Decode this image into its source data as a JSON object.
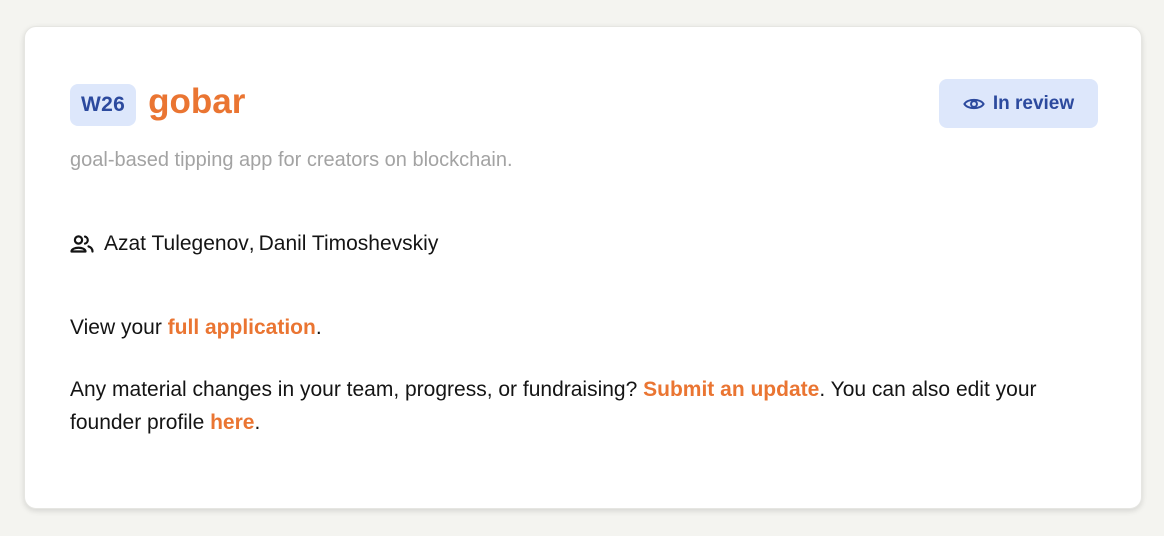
{
  "header": {
    "batch": "W26",
    "company_name": "gobar",
    "tagline": "goal-based tipping app for creators on blockchain."
  },
  "status": {
    "label": "In review",
    "icon": "eye-icon",
    "background": "#dde7fb",
    "color": "#2c4a9e"
  },
  "founders": {
    "icon": "people-icon",
    "names": [
      "Azat Tulegenov",
      "Danil Timoshevskiy"
    ],
    "separator": ","
  },
  "application": {
    "prefix": "View your",
    "link_label": "full application",
    "suffix": "."
  },
  "update": {
    "prefix": "Any material changes in your team, progress, or fundraising?",
    "link_label": "Submit an update",
    "middle": ". You can also edit your founder profile",
    "profile_link_label": "here",
    "suffix": "."
  },
  "colors": {
    "accent": "#ea7532",
    "badge_bg": "#dde7fb",
    "badge_text": "#2c4a9e",
    "muted_text": "#a3a3a3"
  }
}
